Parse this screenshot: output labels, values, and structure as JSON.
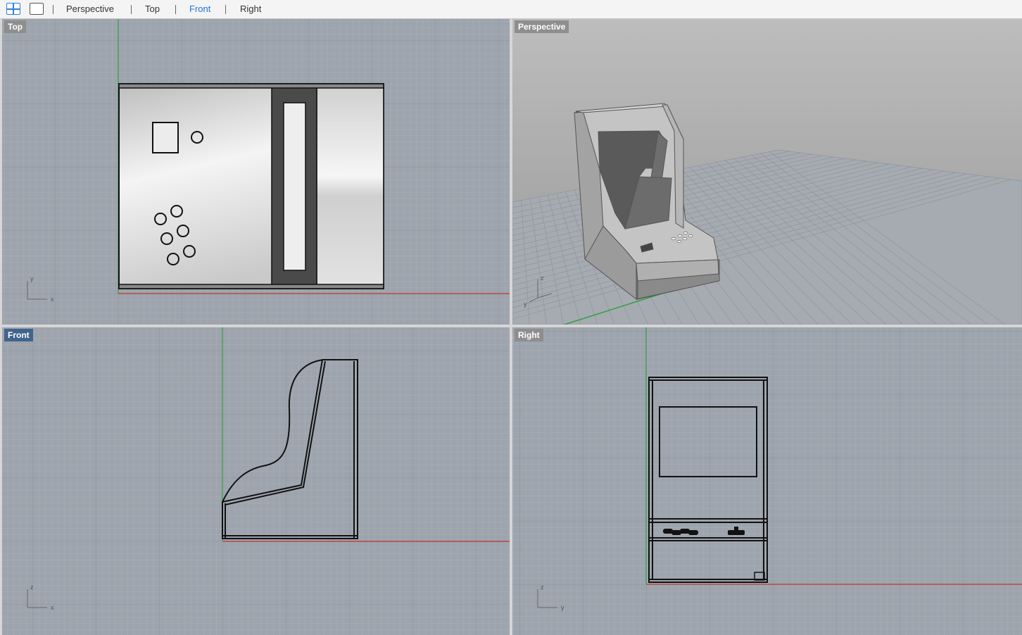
{
  "toolbar": {
    "layout_icons": [
      "four-viewports-icon",
      "single-viewport-icon"
    ],
    "tabs": [
      {
        "label": "Perspective",
        "active": false
      },
      {
        "label": "Top",
        "active": false
      },
      {
        "label": "Front",
        "active": true
      },
      {
        "label": "Right",
        "active": false
      }
    ]
  },
  "viewports": {
    "top": {
      "label": "Top",
      "axis_a": "y",
      "axis_b": "x"
    },
    "perspective": {
      "label": "Perspective",
      "axis_a": "z",
      "axis_b": "y"
    },
    "front": {
      "label": "Front",
      "axis_a": "z",
      "axis_b": "x",
      "active": true
    },
    "right": {
      "label": "Right",
      "axis_a": "z",
      "axis_b": "y"
    }
  },
  "colors": {
    "viewport_bg": "#9da4ad",
    "grid_minor": "#a9afb7",
    "grid_major": "#8e959e",
    "x_axis": "#c0392b",
    "y_axis": "#2ea043",
    "active_label": "#40648c",
    "active_tab": "#1e74d6"
  }
}
